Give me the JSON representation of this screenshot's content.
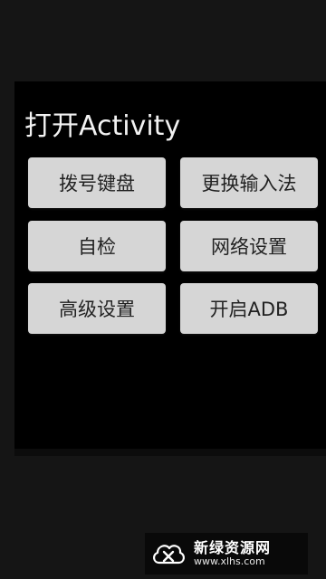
{
  "title": "打开Activity",
  "buttons": [
    {
      "label": "拨号键盘"
    },
    {
      "label": "更换输入法"
    },
    {
      "label": "自检"
    },
    {
      "label": "网络设置"
    },
    {
      "label": "高级设置"
    },
    {
      "label": "开启ADB"
    }
  ],
  "watermark": {
    "name": "新绿资源网",
    "url": "www.xlhs.com",
    "icon": "cloud-x-logo-icon"
  },
  "colors": {
    "background": "#151515",
    "panel": "#000000",
    "button": "#d6d6d6",
    "button_text": "#222222",
    "title_text": "#f2f2f2"
  }
}
